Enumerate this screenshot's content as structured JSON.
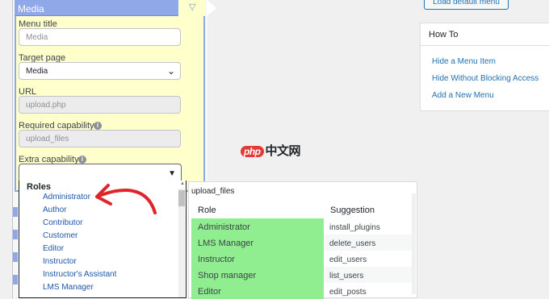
{
  "menu_editor": {
    "panel_title": "Media",
    "menu_title_label": "Menu title",
    "menu_title_placeholder": "Media",
    "target_page_label": "Target page",
    "target_page_value": "Media",
    "url_label": "URL",
    "url_value": "upload.php",
    "required_capability_label": "Required capability",
    "required_capability_value": "upload_files",
    "extra_capability_label": "Extra capability",
    "info_glyph": "i"
  },
  "dropdown": {
    "group_label": "Roles",
    "items": [
      "Administrator",
      "Author",
      "Contributor",
      "Customer",
      "Editor",
      "Instructor",
      "Instructor's Assistant",
      "LMS Manager"
    ]
  },
  "capability_table": {
    "capability": "upload_files",
    "headers": {
      "role": "Role",
      "suggestion": "Suggestion"
    },
    "rows": [
      {
        "role": "Administrator",
        "suggestion": "install_plugins"
      },
      {
        "role": "LMS Manager",
        "suggestion": "delete_users"
      },
      {
        "role": "Instructor",
        "suggestion": "edit_users"
      },
      {
        "role": "Shop manager",
        "suggestion": "list_users"
      },
      {
        "role": "Editor",
        "suggestion": "edit_posts"
      }
    ],
    "highlight_color": "#90ee90"
  },
  "sidebar": {
    "load_default_label": "Load default menu",
    "howto_title": "How To",
    "howto_links": [
      "Hide a Menu Item",
      "Hide Without Blocking Access",
      "Add a New Menu"
    ]
  },
  "watermark": {
    "logo_text": "php",
    "site_text": "中文网"
  },
  "colors": {
    "panel_bg": "#ffffcc",
    "panel_border": "#8fa8e8",
    "link": "#2271b1",
    "arrow": "#e0242b"
  }
}
